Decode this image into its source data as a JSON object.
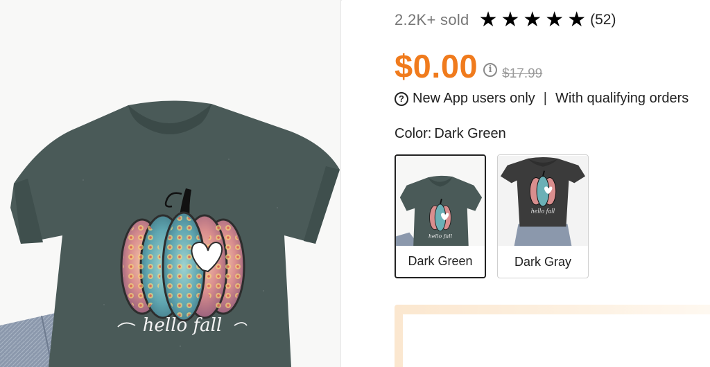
{
  "product": {
    "sold_text": "2.2K+ sold",
    "rating": 5,
    "rating_count": "(52)",
    "price": "$0.00",
    "original_price": "$17.99",
    "notice": {
      "part1": "New App users only",
      "separator": "|",
      "part2": "With qualifying orders"
    },
    "color_label": "Color:",
    "color_value": "Dark Green",
    "swatches": [
      {
        "name": "Dark Green",
        "selected": true
      },
      {
        "name": "Dark Gray",
        "selected": false
      }
    ],
    "shirt_text": "hello fall"
  },
  "colors": {
    "price_orange": "#f07b1d",
    "shirt_dark_green": "#4a5a58",
    "shirt_dark_gray": "#3b3b3b",
    "text_gray": "#777777"
  },
  "icons": {
    "star": "star-icon",
    "info": "info-icon",
    "question": "question-circle-icon"
  }
}
